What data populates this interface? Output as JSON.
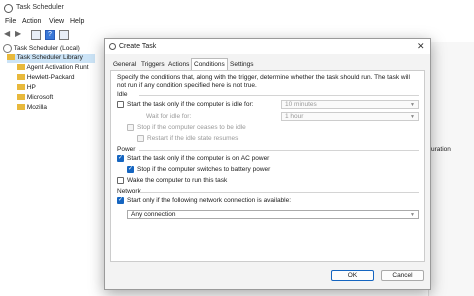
{
  "app": {
    "title": "Task Scheduler",
    "menu": [
      "File",
      "Action",
      "View",
      "Help"
    ],
    "tree": {
      "root": "Task Scheduler (Local)",
      "library": "Task Scheduler Library",
      "folders": [
        "Agent Activation Runt",
        "Hewlett-Packard",
        "HP",
        "Microsoft",
        "Mozilla"
      ]
    },
    "right_text": "uration"
  },
  "dialog": {
    "title": "Create Task",
    "close": "✕",
    "tabs": [
      "General",
      "Triggers",
      "Actions",
      "Conditions",
      "Settings"
    ],
    "active_tab": "Conditions",
    "description": "Specify the conditions that, along with the trigger, determine whether the task should run.  The task will not run  if any condition specified here is not true.",
    "idle": {
      "section": "Idle",
      "start_if_idle": "Start the task only if the computer is idle for:",
      "idle_for_value": "10 minutes",
      "wait_label": "Wait for idle for:",
      "wait_value": "1 hour",
      "stop_if_ceases": "Stop if the computer ceases to be idle",
      "restart": "Restart if the idle state resumes"
    },
    "power": {
      "section": "Power",
      "ac_power": "Start the task only if the computer is on AC power",
      "battery": "Stop if the computer switches to battery power",
      "wake": "Wake the computer to run this task"
    },
    "network": {
      "section": "Network",
      "start_network": "Start only if the following network connection is available:",
      "connection": "Any connection"
    },
    "ok": "OK",
    "cancel": "Cancel"
  }
}
